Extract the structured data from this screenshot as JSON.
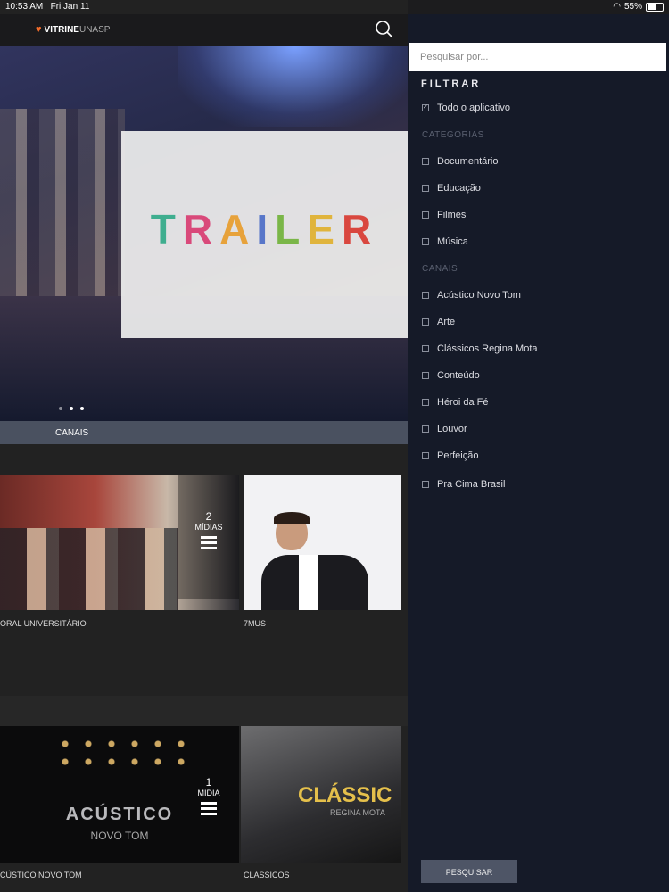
{
  "status": {
    "time": "10:53 AM",
    "date": "Fri Jan 11",
    "battery": "55%"
  },
  "header": {
    "brand": "VITRINE",
    "brand_suffix": "UNASP"
  },
  "banner": {
    "title": "TRAILER",
    "slide_count": 3,
    "active_slide": 1
  },
  "channels_bar": "CANAIS",
  "row1": [
    {
      "label": "ORAL UNIVERSITÁRIO",
      "count": "2",
      "count_word": "MÍDIAS"
    },
    {
      "label": "7MUS"
    }
  ],
  "row2": [
    {
      "label": "CÚSTICO NOVO TOM",
      "count": "1",
      "count_word": "MÍDIA",
      "art_title": "ACÚSTICO",
      "art_sub": "NOVO TOM"
    },
    {
      "label": "CLÁSSICOS",
      "art_title": "CLÁSSIC",
      "art_sub": "REGINA MOTA"
    }
  ],
  "filter": {
    "placeholder": "Pesquisar por...",
    "title": "FILTRAR",
    "all": {
      "label": "Todo o aplicativo",
      "checked": true
    },
    "categories_title": "CATEGORIAS",
    "categories": [
      "Documentário",
      "Educação",
      "Filmes",
      "Música"
    ],
    "channels_title": "CANAIS",
    "channels": [
      "Acústico Novo Tom",
      "Arte",
      "Clássicos Regina Mota",
      "Conteúdo",
      "Héroi da Fé",
      "Louvor",
      "Perfeição",
      "Pra Cima Brasil"
    ],
    "search_button": "PESQUISAR"
  },
  "colors": {
    "accent": "#f26c2a",
    "panel_bg": "#151a28",
    "button_bg": "#4e5566"
  }
}
